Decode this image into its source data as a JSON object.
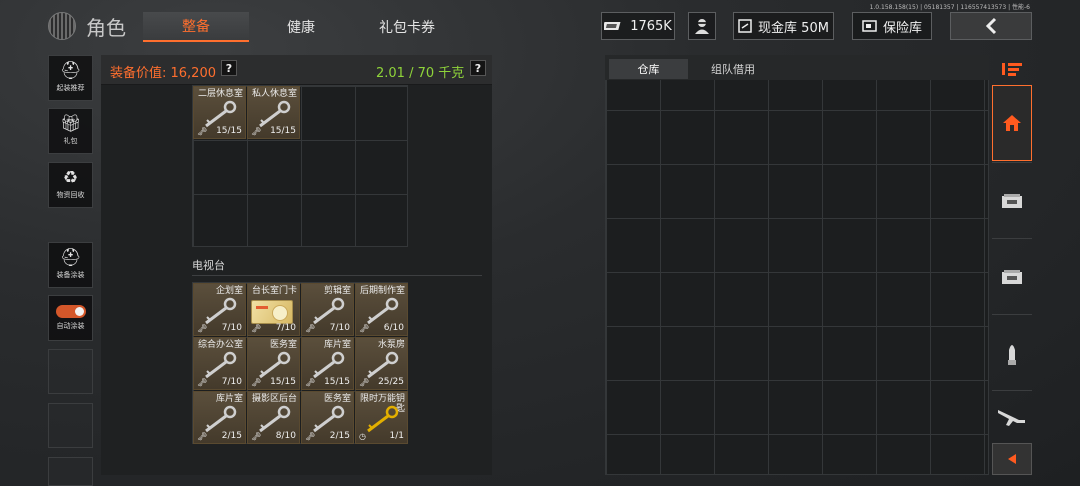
{
  "version": "1.0.158.158(15) | 05181357 | 116557413573 | 性能-6",
  "header": {
    "title": "角色",
    "tabs": [
      {
        "label": "整备",
        "active": true
      },
      {
        "label": "健康",
        "active": false
      },
      {
        "label": "礼包卡券",
        "active": false
      }
    ],
    "currency": "1765K",
    "cash_storage": "现金库 50M",
    "safe_box": "保险库",
    "back_icon": "‹"
  },
  "sidebar": [
    {
      "label": "起装推荐",
      "icon": "helmet-gear-icon"
    },
    {
      "label": "礼包",
      "icon": "gift-icon"
    },
    {
      "label": "物资回收",
      "icon": "recycle-icon"
    },
    {
      "label": "装备涂装",
      "icon": "paint-helmet-icon"
    },
    {
      "label": "自动涂装",
      "icon": "toggle-icon",
      "toggle_on": true
    }
  ],
  "equipment": {
    "value_label": "装备价值: 16,200",
    "weight": "2.01 / 70 千克",
    "help": "?",
    "top_items": [
      {
        "name": "二层休息室",
        "count": "15/15"
      },
      {
        "name": "私人休息室",
        "count": "15/15"
      }
    ],
    "section_label": "电视台",
    "tv_items": [
      {
        "name": "企划室",
        "count": "7/10",
        "type": "key"
      },
      {
        "name": "台长室门卡",
        "count": "7/10",
        "type": "card"
      },
      {
        "name": "剪辑室",
        "count": "7/10",
        "type": "key"
      },
      {
        "name": "后期制作室",
        "count": "6/10",
        "type": "key"
      },
      {
        "name": "综合办公室",
        "count": "7/10",
        "type": "key"
      },
      {
        "name": "医务室",
        "count": "15/15",
        "type": "key"
      },
      {
        "name": "库片室",
        "count": "15/15",
        "type": "key"
      },
      {
        "name": "水泵房",
        "count": "25/25",
        "type": "key"
      },
      {
        "name": "库片室",
        "count": "2/15",
        "type": "key"
      },
      {
        "name": "摄影区后台",
        "count": "8/10",
        "type": "key"
      },
      {
        "name": "医务室",
        "count": "2/15",
        "type": "key"
      },
      {
        "name": "限时万能钥匙",
        "count": "1/1",
        "type": "special"
      }
    ]
  },
  "warehouse": {
    "tabs": [
      {
        "label": "仓库",
        "active": true
      },
      {
        "label": "组队借用",
        "active": false
      }
    ]
  },
  "rightbar": [
    "filter-icon",
    "home-icon",
    "storage-crate-icon",
    "storage-crate-icon",
    "ammo-icon",
    "rifle-icon"
  ],
  "colors": {
    "accent": "#ff6f2e",
    "weight": "#8fd43a",
    "item_bg": "#574b39"
  }
}
